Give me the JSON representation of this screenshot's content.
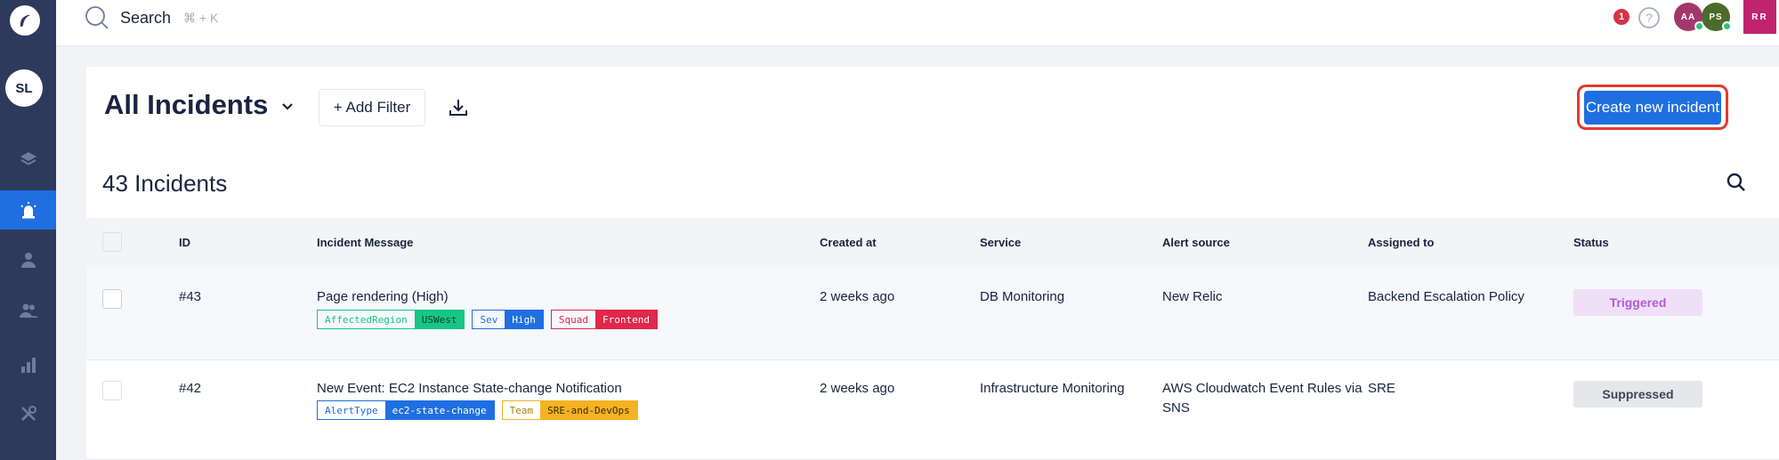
{
  "sidebar": {
    "logo": "app-logo-icon",
    "avatar_initials": "SL",
    "items": [
      {
        "icon": "layers-icon",
        "active": false
      },
      {
        "icon": "incident-alarm-icon",
        "active": true
      },
      {
        "icon": "user-icon",
        "active": false
      },
      {
        "icon": "team-icon",
        "active": false
      },
      {
        "icon": "analytics-icon",
        "active": false
      },
      {
        "icon": "tools-icon",
        "active": false
      }
    ]
  },
  "topbar": {
    "search_label": "Search",
    "search_shortcut": "⌘ + K",
    "notification_count": "1",
    "avatars": [
      {
        "initials": "AA",
        "color": "#a3376b"
      },
      {
        "initials": "PS",
        "color": "#4b6b2a"
      },
      {
        "initials": "RR",
        "color": "#c0246e"
      }
    ]
  },
  "header": {
    "title": "All Incidents",
    "add_filter_label": "+ Add Filter",
    "create_label": "Create new incident"
  },
  "summary": {
    "count_label": "43 Incidents"
  },
  "table": {
    "columns": [
      "ID",
      "Incident Message",
      "Created at",
      "Service",
      "Alert source",
      "Assigned to",
      "Status"
    ],
    "rows": [
      {
        "id": "#43",
        "message": "Page rendering (High)",
        "tags": [
          {
            "key": "AffectedRegion",
            "value": "USWest",
            "color": "#16c784"
          },
          {
            "key": "Sev",
            "value": "High",
            "color": "#1f6fe0"
          },
          {
            "key": "Squad",
            "value": "Frontend",
            "color": "#e0284a"
          }
        ],
        "created_at": "2 weeks ago",
        "service": "DB Monitoring",
        "alert_source": "New Relic",
        "assigned_to": "Backend Escalation Policy",
        "status": "Triggered",
        "status_bg": "#efe0f7",
        "status_fg": "#b15ad6"
      },
      {
        "id": "#42",
        "message": "New Event: EC2 Instance State-change Notification",
        "tags": [
          {
            "key": "AlertType",
            "value": "ec2-state-change",
            "color": "#1f6fe0"
          },
          {
            "key": "Team",
            "value": "SRE-and-DevOps",
            "color": "#f5b323"
          }
        ],
        "created_at": "2 weeks ago",
        "service": "Infrastructure Monitoring",
        "alert_source_line1": "AWS Cloudwatch Event Rules via",
        "alert_source_line2": "SNS",
        "assigned_to": "SRE",
        "status": "Suppressed",
        "status_bg": "#e5e7ea",
        "status_fg": "#3e4658"
      }
    ]
  }
}
